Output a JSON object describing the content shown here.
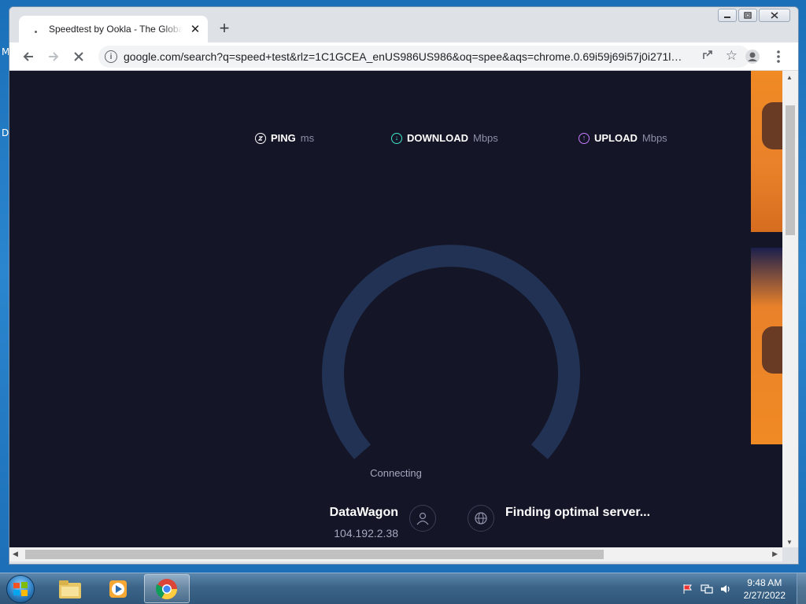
{
  "browser": {
    "tab": {
      "title": "Speedtest by Ookla - The Global",
      "close_icon": "close-icon"
    },
    "window_controls": [
      "minimize-icon",
      "maximize-icon",
      "close-icon"
    ],
    "url": "google.com/search?q=speed+test&rlz=1C1GCEA_enUS986US986&oq=spee&aqs=chrome.0.69i59j69i57j0i271l2j..."
  },
  "speedtest": {
    "metrics": [
      {
        "label": "PING",
        "unit": "ms",
        "color": "#ffffff"
      },
      {
        "label": "DOWNLOAD",
        "unit": "Mbps",
        "color": "#42e6c9"
      },
      {
        "label": "UPLOAD",
        "unit": "Mbps",
        "color": "#c77dff"
      }
    ],
    "status": "Connecting",
    "isp_name": "DataWagon",
    "isp_ip": "104.192.2.38",
    "server_status": "Finding optimal server...",
    "gauge_color": "#223254",
    "background_color": "#141526"
  },
  "taskbar": {
    "clock_time": "9:48 AM",
    "clock_date": "2/27/2022",
    "apps": [
      "file-explorer-icon",
      "media-player-icon",
      "chrome-icon"
    ]
  },
  "desktop": {
    "edge_glyph_1": "M",
    "edge_glyph_2": "D"
  }
}
